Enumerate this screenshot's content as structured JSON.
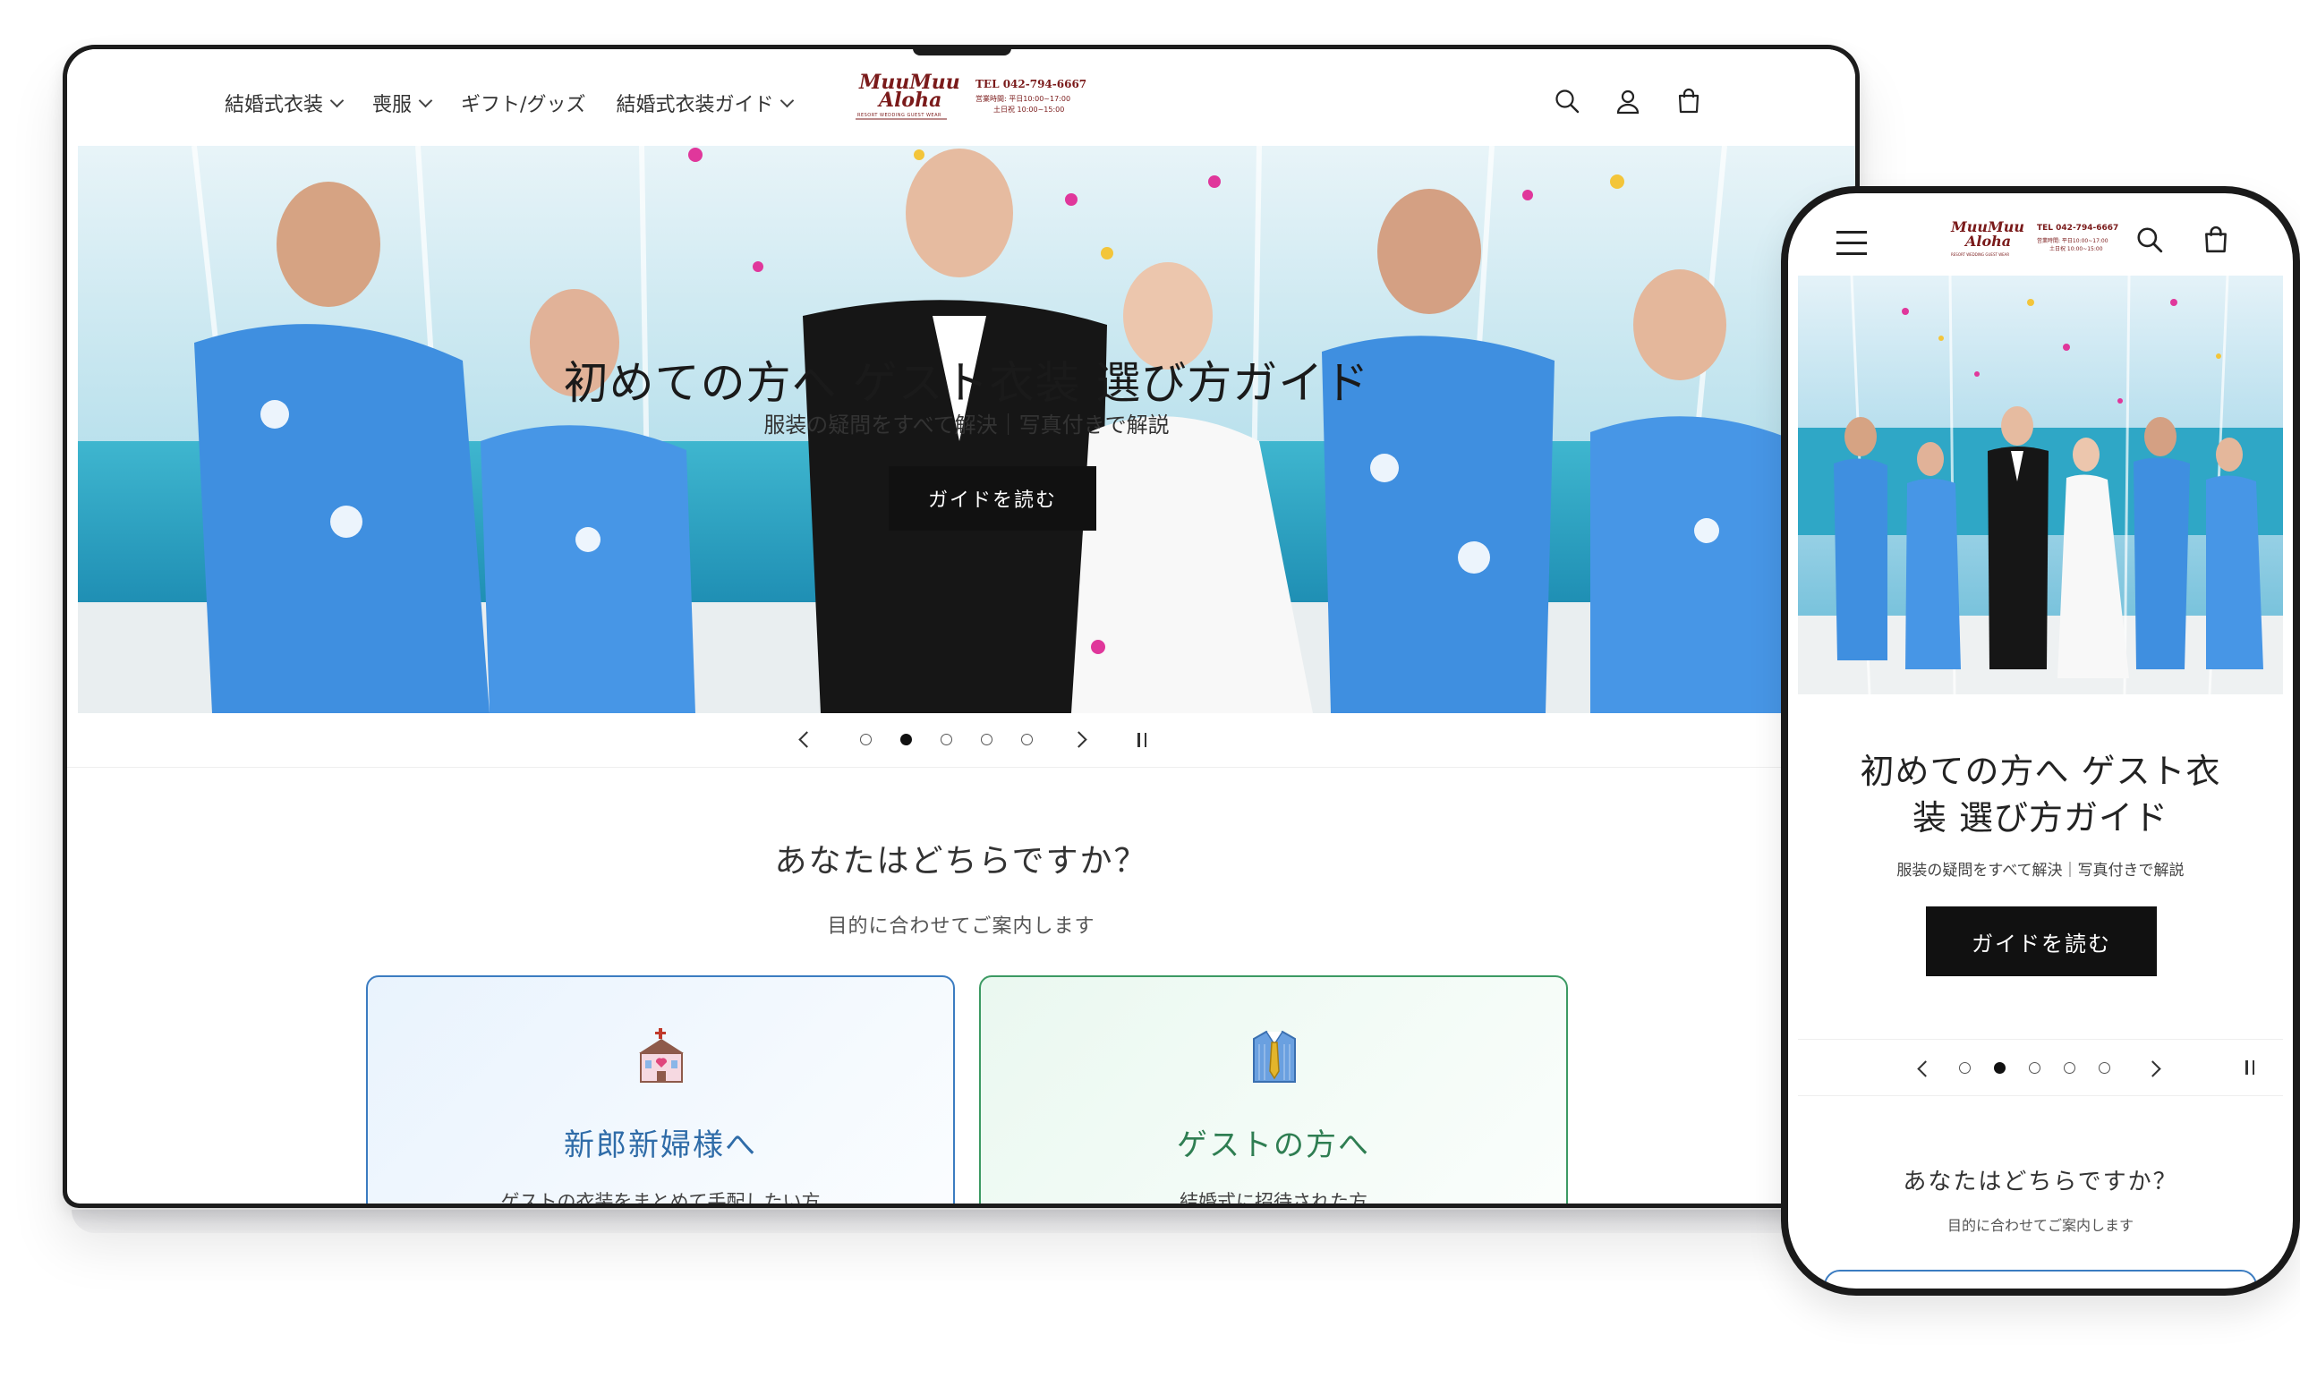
{
  "desktop": {
    "nav": [
      {
        "label": "結婚式衣装",
        "has_dropdown": true
      },
      {
        "label": "喪服",
        "has_dropdown": true
      },
      {
        "label": "ギフト/グッズ",
        "has_dropdown": false
      },
      {
        "label": "結婚式衣装ガイド",
        "has_dropdown": true
      }
    ],
    "logo": {
      "line1": "MuuMuu",
      "line2": "Aloha",
      "tagline": "RESORT WEDDING GUEST WEAR",
      "tel": "TEL 042-794-6667",
      "hours1": "営業時間: 平日10:00~17:00",
      "hours2": "土日祝 10:00~15:00"
    },
    "header_icons": [
      "search-icon",
      "account-icon",
      "cart-icon"
    ],
    "hero": {
      "title": "初めての方へ ゲスト衣装 選び方ガイド",
      "subtitle": "服装の疑問をすべて解決｜写真付きで解説",
      "button": "ガイドを読む"
    },
    "slider": {
      "count": 5,
      "active_index": 1
    },
    "section": {
      "title": "あなたはどちらですか？",
      "subtitle": "目的に合わせてご案内します"
    },
    "cards": [
      {
        "title": "新郎新婦様へ",
        "desc": "ゲストの衣装をまとめて手配したい方",
        "icon": "chapel-icon"
      },
      {
        "title": "ゲストの方へ",
        "desc": "結婚式に招待された方",
        "icon": "shirt-tie-icon"
      }
    ]
  },
  "mobile": {
    "hero": {
      "title_line1": "初めての方へ ゲスト衣",
      "title_line2": "装 選び方ガイド",
      "subtitle": "服装の疑問をすべて解決｜写真付きで解説",
      "button": "ガイドを読む"
    },
    "slider": {
      "count": 5,
      "active_index": 1
    },
    "section": {
      "title": "あなたはどちらですか？",
      "subtitle": "目的に合わせてご案内します"
    }
  },
  "colors": {
    "accent_dark": "#111111",
    "logo_red": "#7a1a1a",
    "couple_blue": "#2f6ca8",
    "guest_green": "#2f7e52"
  }
}
